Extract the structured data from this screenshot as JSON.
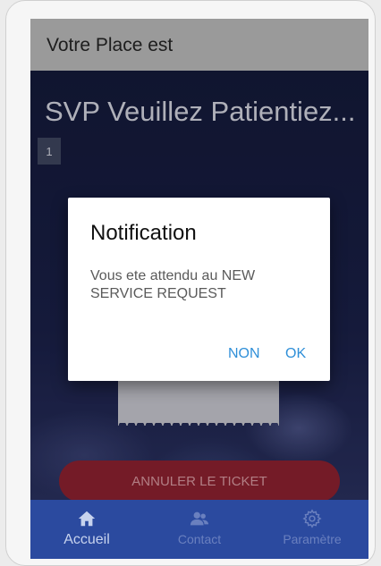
{
  "header": {
    "title": "Votre Place est"
  },
  "main": {
    "waiting_text": "SVP Veuillez Patientiez...",
    "queue_number": "1",
    "cancel_button_label": "ANNULER LE TICKET"
  },
  "dialog": {
    "title": "Notification",
    "message": "Vous ete attendu au NEW SERVICE REQUEST",
    "no_label": "NON",
    "ok_label": "OK",
    "button_color": "#2f8fd8"
  },
  "bottom_nav": {
    "items": [
      {
        "label": "Accueil",
        "icon": "home-icon",
        "active": true
      },
      {
        "label": "Contact",
        "icon": "contacts-icon",
        "active": false
      },
      {
        "label": "Paramètre",
        "icon": "gear-icon",
        "active": false
      }
    ]
  },
  "colors": {
    "header_bg": "#9a9a9a",
    "nav_bg": "#2b4a9f",
    "cancel_bg": "#8e2230"
  }
}
